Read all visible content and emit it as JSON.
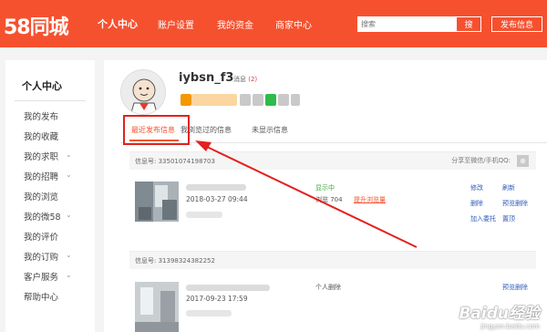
{
  "header": {
    "logo": "58同城",
    "nav": [
      "个人中心",
      "账户设置",
      "我的资金",
      "商家中心"
    ],
    "search_placeholder": "搜索",
    "search_button": "搜",
    "post_button": "发布信息"
  },
  "sidebar": {
    "title": "个人中心",
    "items": [
      {
        "label": "我的发布",
        "chevron": false
      },
      {
        "label": "我的收藏",
        "chevron": false
      },
      {
        "label": "我的求职",
        "chevron": true
      },
      {
        "label": "我的招聘",
        "chevron": true
      },
      {
        "label": "我的浏览",
        "chevron": false
      },
      {
        "label": "我的微58",
        "chevron": true
      },
      {
        "label": "我的评价",
        "chevron": false
      },
      {
        "label": "我的订购",
        "chevron": true
      },
      {
        "label": "客户服务",
        "chevron": true
      },
      {
        "label": "帮助中心",
        "chevron": false
      }
    ]
  },
  "profile": {
    "username": "iybsn_f3",
    "message_label": "消息",
    "message_count": "(2)",
    "badge_colors": [
      "#f39800",
      "#c9c9c9",
      "#c9c9c9",
      "#2dbb4d",
      "#c9c9c9",
      "#c9c9c9"
    ]
  },
  "tabs": [
    "最近发布信息",
    "我浏览过的信息",
    "未显示信息"
  ],
  "listings": [
    {
      "info_no": "信息号: 33501074198703",
      "share_label": "分享至微信/手机QQ:",
      "date": "2018-03-27 09:44",
      "status": "显示中",
      "views": "浏览 704",
      "promote": "提升浏览量",
      "actions": [
        "修改",
        "刷新",
        "删除",
        "预览删除",
        "加入委托",
        "置顶"
      ]
    },
    {
      "info_no": "信息号: 31398324382252",
      "date": "2017-09-23 17:59",
      "status": "个人删除",
      "actions": [
        "预览删除"
      ]
    }
  ],
  "watermark": {
    "brand": "Baidu经验",
    "url": "jingyan.baidu.com"
  },
  "colors": {
    "brand": "#f5512f",
    "highlight": "#e3211e",
    "link": "#2f5bb7",
    "status_ok": "#3aa63a"
  }
}
